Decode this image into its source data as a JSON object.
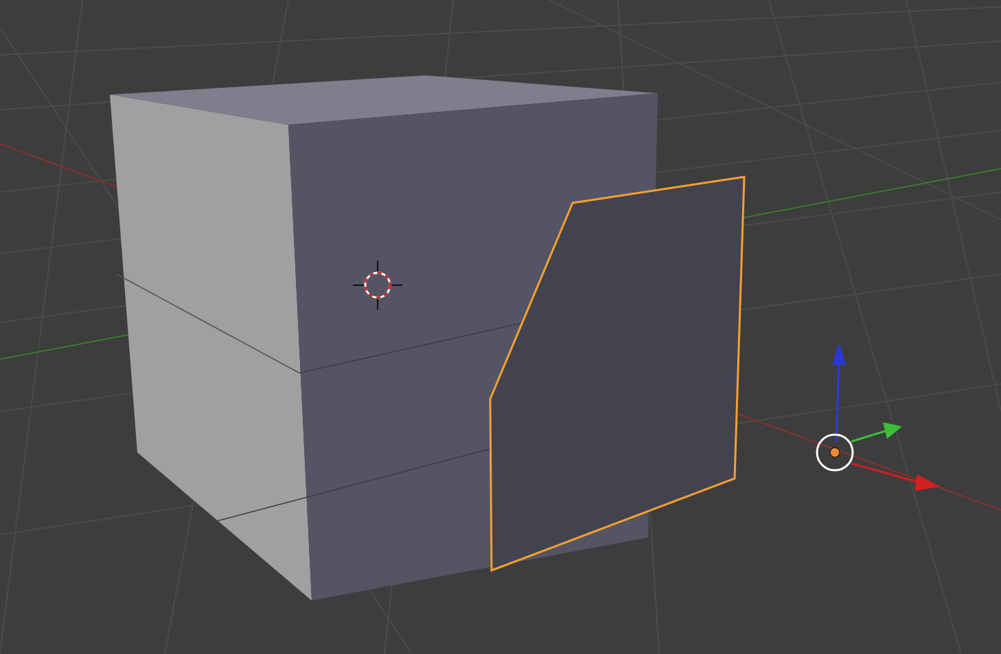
{
  "objects": [
    {
      "kind": "cube",
      "selected": false
    },
    {
      "kind": "plane",
      "selected": true
    }
  ]
}
